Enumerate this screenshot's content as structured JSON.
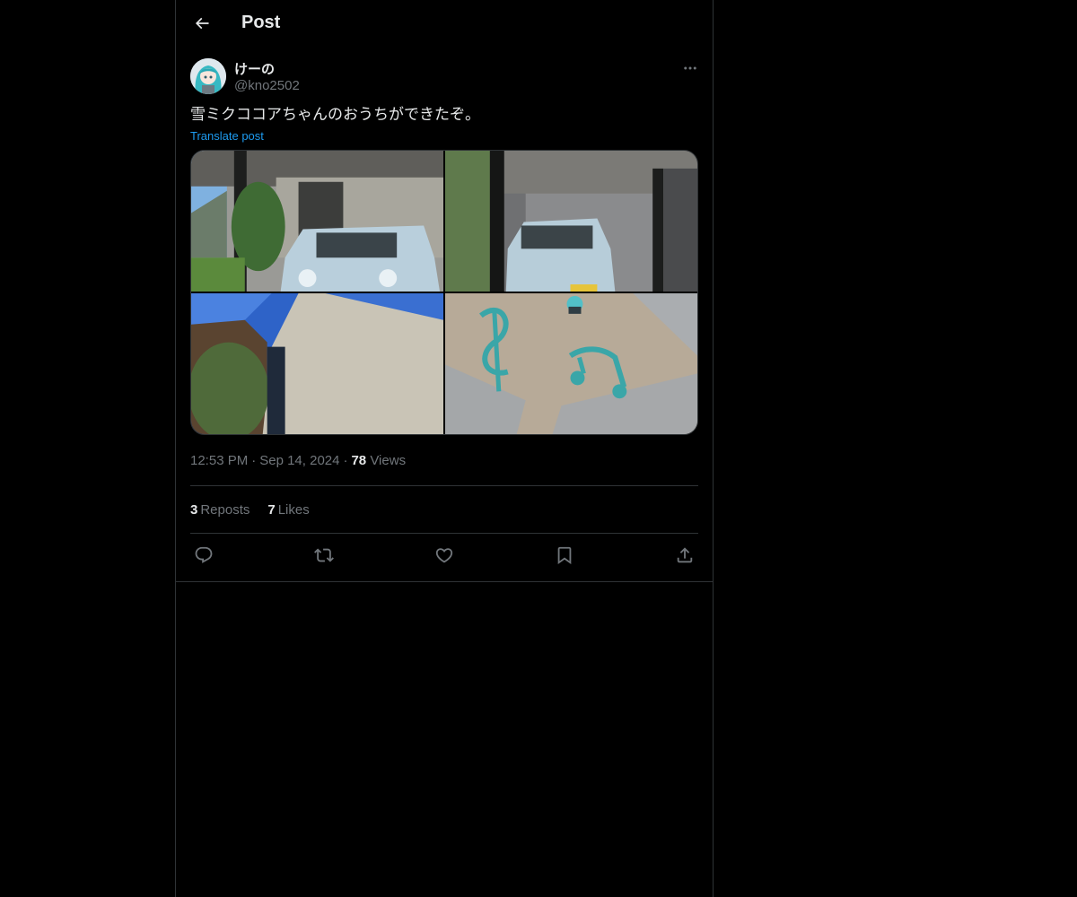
{
  "header": {
    "title": "Post"
  },
  "post": {
    "author": {
      "display_name": "けーの",
      "handle": "@kno2502"
    },
    "text": "雪ミクココアちゃんのおうちができたぞ。",
    "translate_label": "Translate post",
    "time": "12:53 PM",
    "date": "Sep 14, 2024",
    "views_count": "78",
    "views_label": "Views",
    "reposts_count": "3",
    "reposts_label": "Reposts",
    "likes_count": "7",
    "likes_label": "Likes"
  },
  "icons": {
    "back": "arrow-left-icon",
    "more": "more-horizontal-icon",
    "reply": "reply-icon",
    "repost": "repost-icon",
    "like": "heart-icon",
    "bookmark": "bookmark-icon",
    "share": "share-icon"
  },
  "colors": {
    "background": "#000000",
    "text": "#e7e9ea",
    "secondary": "#71767b",
    "accent": "#1d9bf0",
    "border": "#2f3336"
  }
}
